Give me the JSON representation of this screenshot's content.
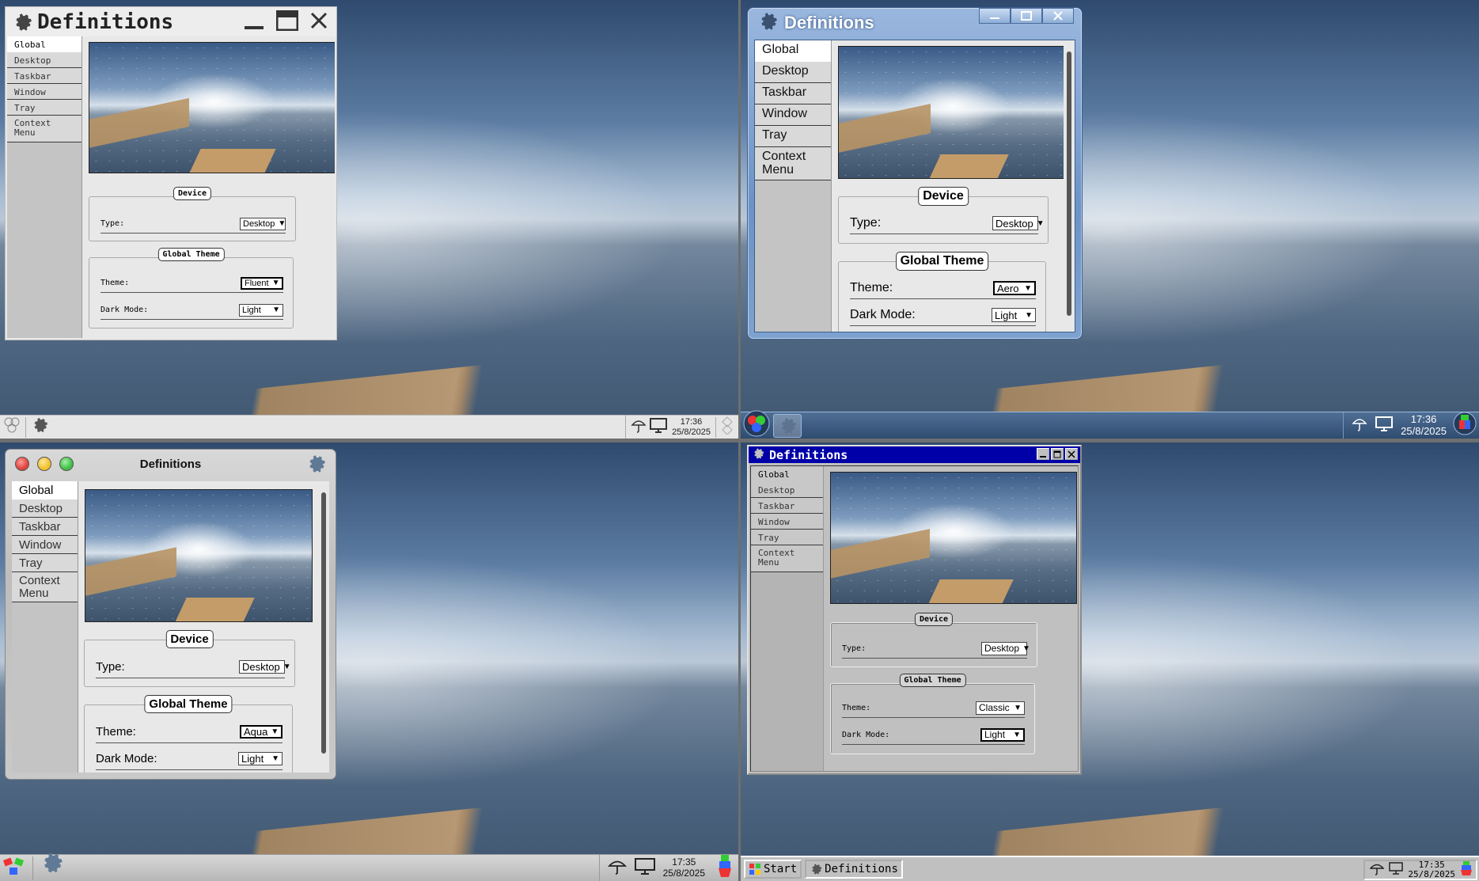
{
  "window_title": "Definitions",
  "tabs": [
    "Global",
    "Desktop",
    "Taskbar",
    "Window",
    "Tray",
    "Context Menu"
  ],
  "device_group": {
    "title": "Device",
    "type_label": "Type:",
    "type_value": "Desktop"
  },
  "theme_group": {
    "title": "Global Theme",
    "theme_label": "Theme:",
    "dark_mode_label": "Dark Mode:",
    "dark_mode_value": "Light"
  },
  "quadrants": {
    "fluent": {
      "theme_value": "Fluent",
      "clock_time": "17:36",
      "clock_date": "25/8/2025"
    },
    "aero": {
      "theme_value": "Aero",
      "clock_time": "17:36",
      "clock_date": "25/8/2025"
    },
    "aqua": {
      "theme_value": "Aqua",
      "clock_time": "17:35",
      "clock_date": "25/8/2025"
    },
    "classic": {
      "theme_value": "Classic",
      "clock_time": "17:35",
      "clock_date": "25/8/2025",
      "start_label": "Start",
      "task_label": "Definitions"
    }
  },
  "icons": [
    "gear-icon",
    "minimize-icon",
    "maximize-icon",
    "close-icon",
    "umbrella-icon",
    "monitor-icon",
    "start-menu-icon",
    "chevron-down-icon"
  ],
  "colors": {
    "classic_titlebar": "#0000a8",
    "aqua_close": "#e0443e",
    "aqua_minimize": "#f2c02b",
    "aqua_zoom": "#3fbf45"
  }
}
